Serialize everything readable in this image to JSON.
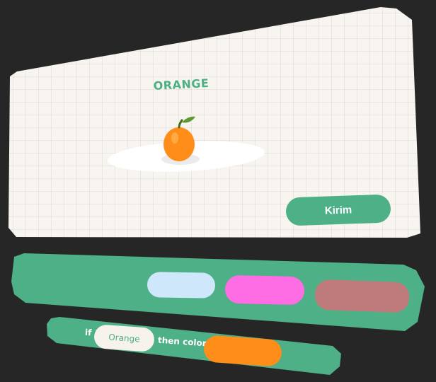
{
  "card": {
    "title": "ORANGE",
    "action_label": "Kirim"
  },
  "swatches": [
    {
      "name": "light-blue",
      "color": "#cfe7fb"
    },
    {
      "name": "pink",
      "color": "#ff6de5"
    },
    {
      "name": "rose",
      "color": "#bf7b7b"
    }
  ],
  "rule": {
    "if_label": "if",
    "value": "Orange",
    "then_label": "then color",
    "selected_color": "#ff8d1a"
  },
  "icons": {
    "fruit": "orange-icon"
  },
  "colors": {
    "background": "#262626",
    "accent": "#4db086",
    "card": "#f8f4ef"
  }
}
